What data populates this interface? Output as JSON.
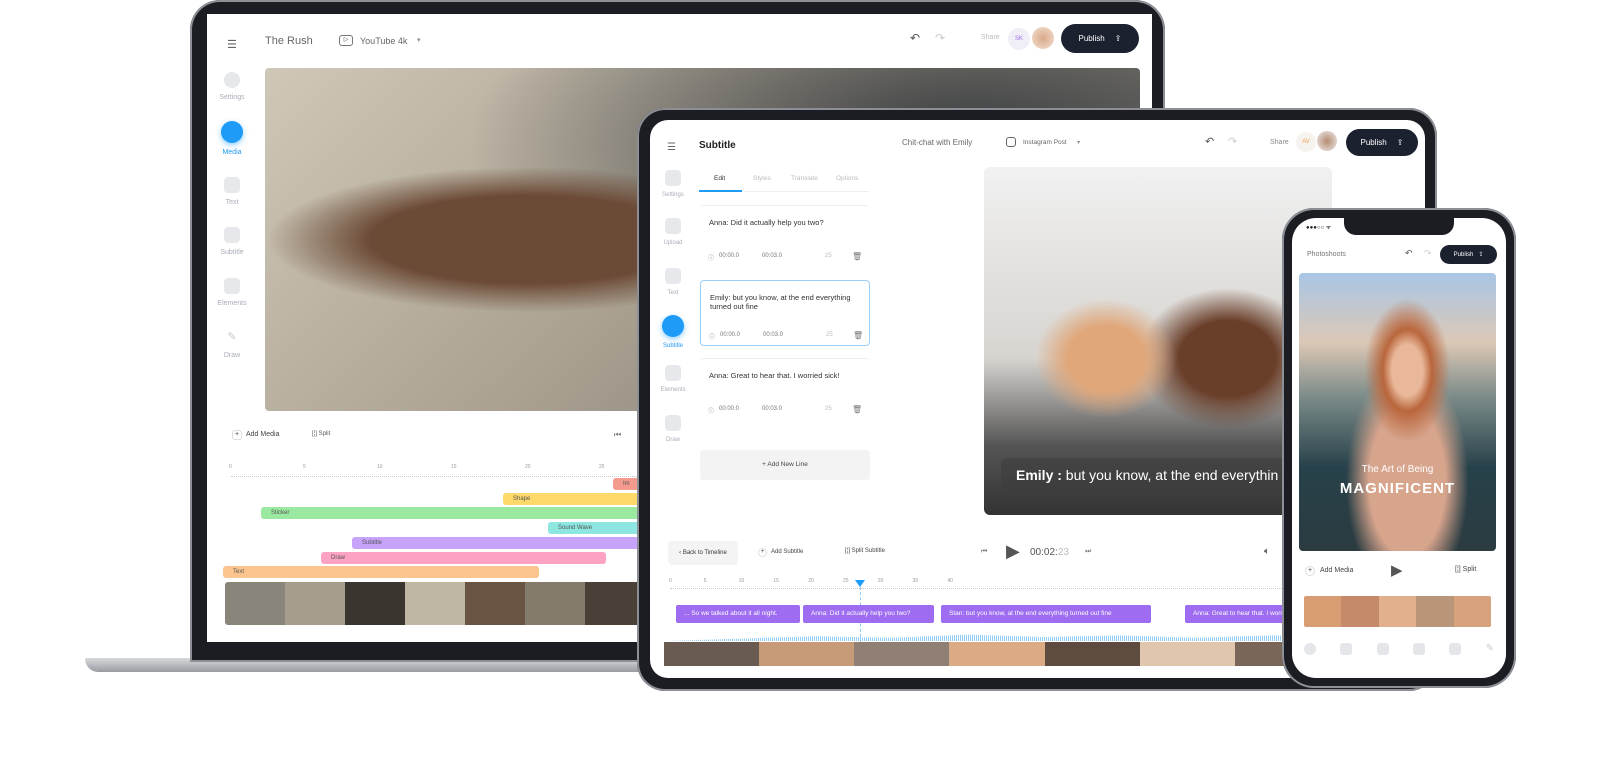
{
  "laptop": {
    "project_title": "The Rush",
    "format": "YouTube 4k",
    "share_label": "Share",
    "avatar_initials": "SK",
    "publish_label": "Publish",
    "sidebar": [
      {
        "label": "Settings"
      },
      {
        "label": "Media",
        "active": true
      },
      {
        "label": "Text"
      },
      {
        "label": "Subtitle"
      },
      {
        "label": "Elements"
      },
      {
        "label": "Draw"
      }
    ],
    "toolbar": {
      "add_media": "Add Media",
      "split": "Split"
    },
    "ruler": [
      "0",
      "5",
      "10",
      "15",
      "20",
      "25"
    ],
    "tracks": [
      {
        "label": "Im",
        "color": "#f59a8f"
      },
      {
        "label": "Shape",
        "color": "#fdd96a"
      },
      {
        "label": "Sticker",
        "color": "#9be8a0"
      },
      {
        "label": "Sound Wave",
        "color": "#8de6e0"
      },
      {
        "label": "Subtitle",
        "color": "#c7a3fb"
      },
      {
        "label": "Draw",
        "color": "#fca3c4"
      },
      {
        "label": "Text",
        "color": "#fcc58f"
      }
    ]
  },
  "tablet": {
    "panel_title": "Subtitle",
    "project_title": "Chit-chat with Emily",
    "format": "Instagram Post",
    "share_label": "Share",
    "avatar_initials": "AV",
    "publish_label": "Publish",
    "tabs": [
      {
        "label": "Edit",
        "active": true
      },
      {
        "label": "Styles"
      },
      {
        "label": "Translate"
      },
      {
        "label": "Options"
      }
    ],
    "sidebar": [
      {
        "label": "Settings"
      },
      {
        "label": "Upload"
      },
      {
        "label": "Text"
      },
      {
        "label": "Subtitle",
        "active": true
      },
      {
        "label": "Elements"
      },
      {
        "label": "Draw"
      }
    ],
    "subtitle_lines": [
      {
        "text": "Anna: Did it actually help you two?",
        "start": "00:00.0",
        "end": "00:03.0",
        "count": "25"
      },
      {
        "text": "Emily: but you know, at the end everything turned out fine",
        "start": "00:00.0",
        "end": "00:03.0",
        "count": "25",
        "selected": true
      },
      {
        "text": "Anna: Great to hear that. I worried sick!",
        "start": "00:00.0",
        "end": "00:03.0",
        "count": "25"
      }
    ],
    "add_new_line": "+ Add New Line",
    "caption_speaker": "Emily :",
    "caption_text": " but you know, at the end everythin",
    "controls": {
      "back": "Back to Timeline",
      "add_subtitle": "Add Subtitle",
      "split_subtitle": "Split Subtitle",
      "time_main": "00:02:",
      "time_frames": "23"
    },
    "ruler": [
      "0",
      "5",
      "10",
      "15",
      "20",
      "25",
      "30",
      "35",
      "40"
    ],
    "playhead_seconds": 27.5,
    "timeline_subtitles": [
      "... So we talked about it all night.",
      "Anna: Did it actually help you two?",
      "Stan: but you know, at the end everything turned out fine",
      "Anna: Great to hear that. I worried sick!"
    ]
  },
  "phone": {
    "project_title": "Photoshoots",
    "publish_label": "Publish",
    "overlay_small": "The Art of Being",
    "overlay_big": "MAGNIFICENT",
    "add_media": "Add Media",
    "split": "Split"
  },
  "colors": {
    "accent": "#1e9bf7",
    "subtitle_purple": "#9d6cf0",
    "dark": "#1c2130"
  }
}
